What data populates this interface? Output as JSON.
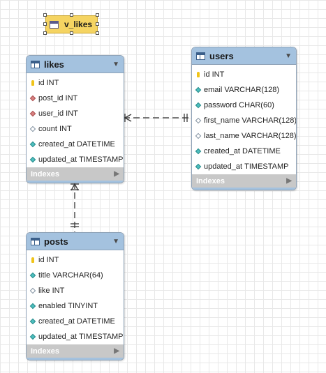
{
  "view": {
    "name": "v_likes"
  },
  "tables": {
    "likes": {
      "name": "likes",
      "columns": [
        {
          "name": "id",
          "type": "INT",
          "kind": "pk"
        },
        {
          "name": "post_id",
          "type": "INT",
          "kind": "fk"
        },
        {
          "name": "user_id",
          "type": "INT",
          "kind": "fk"
        },
        {
          "name": "count",
          "type": "INT",
          "kind": "plain"
        },
        {
          "name": "created_at",
          "type": "DATETIME",
          "kind": "nn"
        },
        {
          "name": "updated_at",
          "type": "TIMESTAMP",
          "kind": "nn"
        }
      ],
      "indexes_label": "Indexes"
    },
    "users": {
      "name": "users",
      "columns": [
        {
          "name": "id",
          "type": "INT",
          "kind": "pk"
        },
        {
          "name": "email",
          "type": "VARCHAR(128)",
          "kind": "nn"
        },
        {
          "name": "password",
          "type": "CHAR(60)",
          "kind": "nn"
        },
        {
          "name": "first_name",
          "type": "VARCHAR(128)",
          "kind": "plain"
        },
        {
          "name": "last_name",
          "type": "VARCHAR(128)",
          "kind": "plain"
        },
        {
          "name": "created_at",
          "type": "DATETIME",
          "kind": "nn"
        },
        {
          "name": "updated_at",
          "type": "TIMESTAMP",
          "kind": "nn"
        }
      ],
      "indexes_label": "Indexes"
    },
    "posts": {
      "name": "posts",
      "columns": [
        {
          "name": "id",
          "type": "INT",
          "kind": "pk"
        },
        {
          "name": "title",
          "type": "VARCHAR(64)",
          "kind": "nn"
        },
        {
          "name": "like",
          "type": "INT",
          "kind": "plain"
        },
        {
          "name": "enabled",
          "type": "TINYINT",
          "kind": "nn"
        },
        {
          "name": "created_at",
          "type": "DATETIME",
          "kind": "nn"
        },
        {
          "name": "updated_at",
          "type": "TIMESTAMP",
          "kind": "nn"
        }
      ],
      "indexes_label": "Indexes"
    }
  },
  "relationships": [
    {
      "from": "likes",
      "to": "users",
      "from_end": "many",
      "to_end": "one"
    },
    {
      "from": "likes",
      "to": "posts",
      "from_end": "many",
      "to_end": "one"
    }
  ],
  "colors": {
    "header": "#a4c2df",
    "view": "#f5d462",
    "indexes": "#c8c8c8"
  }
}
